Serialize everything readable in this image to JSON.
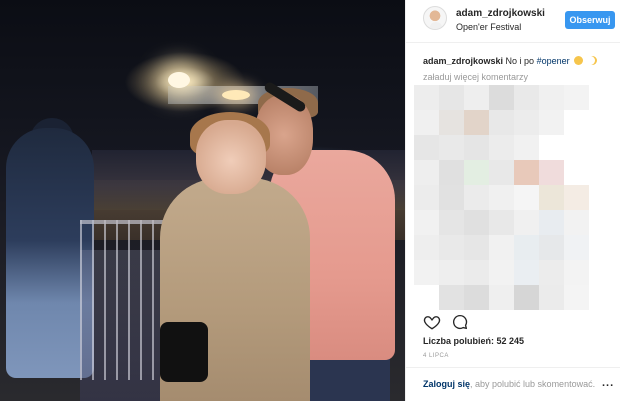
{
  "post": {
    "username": "adam_zdrojkowski",
    "location": "Open'er Festival",
    "follow_label": "Obserwuj",
    "caption_user": "adam_zdrojkowski",
    "caption_text": "No i po",
    "caption_hashtag": "#opener",
    "caption_emojis": [
      "frowning-face-emoji",
      "crescent-moon-emoji"
    ],
    "load_more_comments": "załaduj więcej komentarzy",
    "likes_label": "Liczba polubień:",
    "likes_count": "52 245",
    "date": "4 LIPCA"
  },
  "footer": {
    "login_link": "Zaloguj się",
    "login_rest": ", aby polubić lub skomentować.",
    "more_label": "..."
  },
  "icons": [
    "heart-icon",
    "comment-icon",
    "more-options-icon"
  ],
  "colors": {
    "follow_button": "#3897f0",
    "hashtag": "#003569",
    "muted_text": "#999999",
    "text": "#262626"
  },
  "mosaic_colors": [
    "#ededed",
    "#e6e6e6",
    "#eeeeee",
    "#dcdcdc",
    "#e9e9e9",
    "#f0f0f0",
    "#f3f3f3",
    "#ffffff",
    "#f0f0f0",
    "#e6e3e0",
    "#e2d4c9",
    "#e8e8e8",
    "#ececec",
    "#f2f2f2",
    "#ffffff",
    "#ffffff",
    "#e6e6e6",
    "#e9e9e9",
    "#e5e5e5",
    "#ececec",
    "#f1f1f1",
    "#ffffff",
    "#ffffff",
    "#ffffff",
    "#eeeeee",
    "#e0e0e0",
    "#e3eee2",
    "#e8e8e8",
    "#e8c9ba",
    "#f0dcdc",
    "#ffffff",
    "#ffffff",
    "#ececec",
    "#e1e1e1",
    "#ebebeb",
    "#f0f0f0",
    "#f5f5f5",
    "#ece6d9",
    "#f4ece4",
    "#ffffff",
    "#f1f1f1",
    "#e5e5e5",
    "#e0e0e0",
    "#e8e8e8",
    "#f0f0f0",
    "#e8ecf0",
    "#f2f2f2",
    "#ffffff",
    "#eeeeee",
    "#e9e9e9",
    "#e6e6e6",
    "#f1f1f1",
    "#e8edf0",
    "#e6e8ea",
    "#f0f2f4",
    "#ffffff",
    "#f2f2f2",
    "#eeeeee",
    "#ebebeb",
    "#f2f2f2",
    "#eaeef2",
    "#ececec",
    "#f3f3f3",
    "#ffffff",
    "#ffffff",
    "#e2e2e2",
    "#dcdcdc",
    "#efefef",
    "#d6d6d6",
    "#ebebeb",
    "#f4f4f4",
    "#ffffff"
  ]
}
